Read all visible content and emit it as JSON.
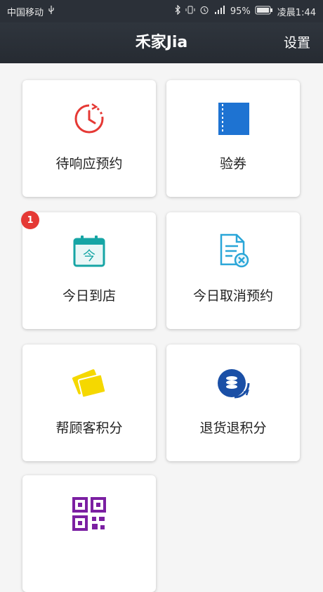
{
  "status_bar": {
    "carrier": "中国移动",
    "battery": "95%",
    "time": "凌晨1:44"
  },
  "header": {
    "title": "禾家Jia",
    "settings_label": "设置"
  },
  "tiles": [
    {
      "label": "待响应预约",
      "icon": "clock-icon"
    },
    {
      "label": "验券",
      "icon": "ticket-icon"
    },
    {
      "label": "今日到店",
      "icon": "calendar-today-icon",
      "badge": "1"
    },
    {
      "label": "今日取消预约",
      "icon": "cancel-document-icon"
    },
    {
      "label": "帮顾客积分",
      "icon": "cards-icon"
    },
    {
      "label": "退货退积分",
      "icon": "coins-return-icon"
    },
    {
      "label": "",
      "icon": "qr-code-icon"
    }
  ],
  "colors": {
    "header_bg": "#2b3038",
    "clock": "#e53935",
    "ticket": "#1e73d2",
    "calendar": "#16a5a5",
    "cancel_doc": "#2aa6d8",
    "cards": "#f5d800",
    "coins": "#1a4fa6",
    "qr": "#7b1fa2",
    "badge": "#e53935"
  }
}
